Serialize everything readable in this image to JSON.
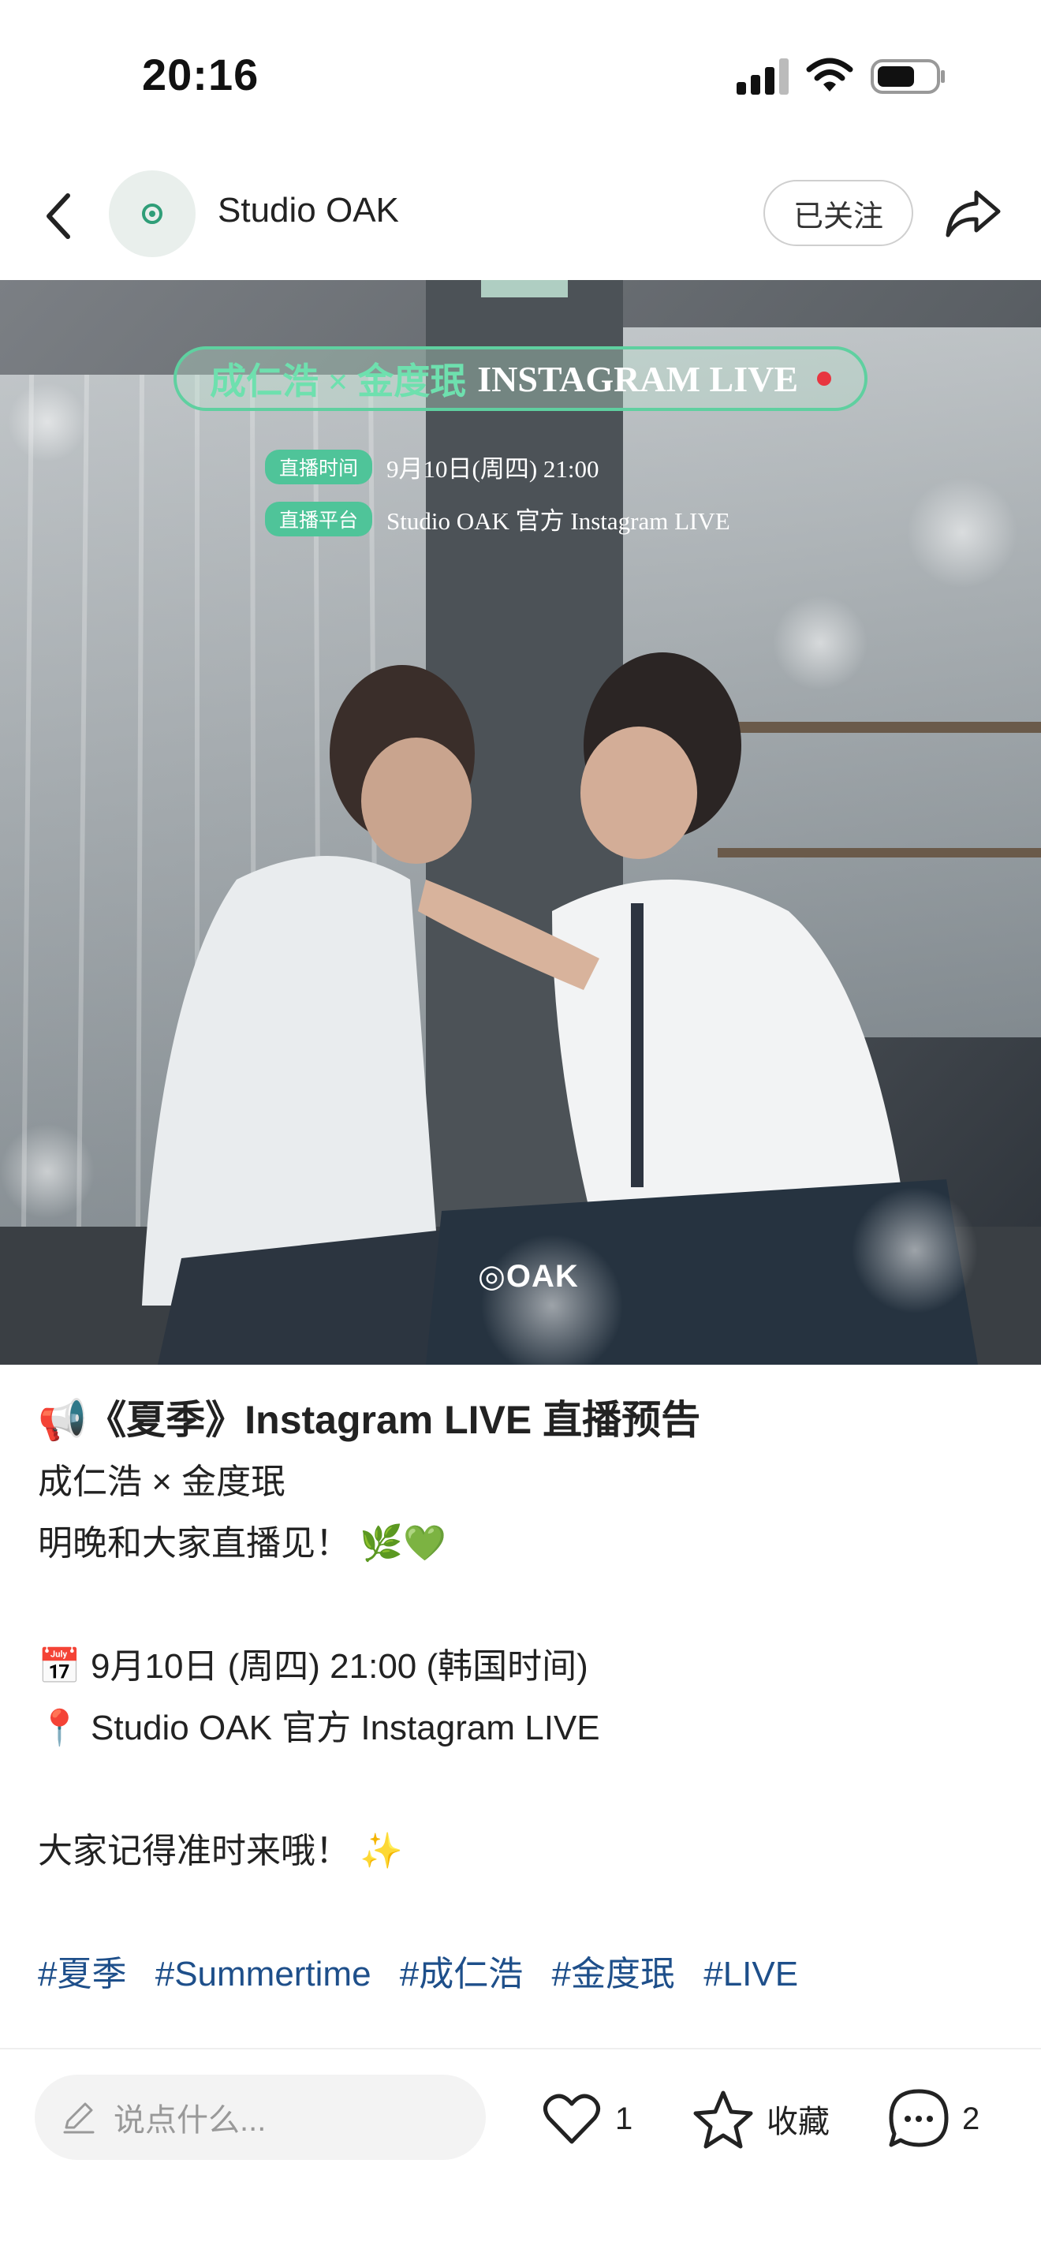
{
  "status_bar": {
    "time": "20:16"
  },
  "nav": {
    "account_name": "Studio OAK",
    "follow_label": "已关注"
  },
  "hero": {
    "live_banner_cn": "成仁浩 × 金度珉",
    "live_banner_en": "INSTAGRAM LIVE",
    "info": [
      {
        "tag": "直播时间",
        "value": "9月10日(周四) 21:00"
      },
      {
        "tag": "直播平台",
        "value": "Studio OAK 官方 Instagram LIVE"
      }
    ],
    "watermark": "OAK"
  },
  "post": {
    "title": "📢《夏季》Instagram LIVE 直播预告",
    "lines": [
      "成仁浩 × 金度珉",
      "明晚和大家直播见！ 🌿💚",
      "",
      "📅 9月10日 (周四) 21:00 (韩国时间)",
      "📍 Studio OAK 官方 Instagram LIVE",
      "",
      "大家记得准时来哦！ ✨",
      ""
    ],
    "hashtags": [
      "#夏季",
      "#Summertime",
      "#成仁浩",
      "#金度珉",
      "#LIVE"
    ]
  },
  "bottom_bar": {
    "comment_placeholder": "说点什么...",
    "like_count": "1",
    "favorite_label": "收藏",
    "comment_count": "2"
  },
  "colors": {
    "accent_green": "#4fc499",
    "hashtag_blue": "#1e4f8a",
    "live_dot": "#e83540"
  },
  "icons": [
    "back-chevron-icon",
    "share-arrow-icon",
    "heart-icon",
    "star-icon",
    "comment-bubble-icon",
    "pencil-icon",
    "signal-icon",
    "wifi-icon",
    "battery-icon"
  ]
}
